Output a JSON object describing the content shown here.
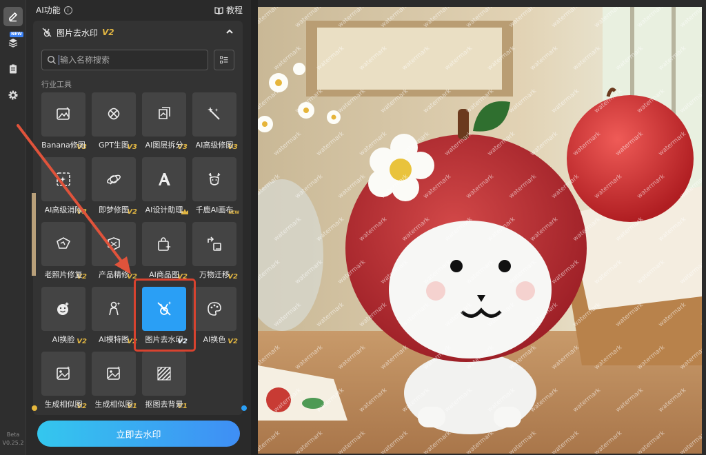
{
  "rail": {
    "new_tag": "NEW",
    "version_line1": "Beta",
    "version_line2": "V0.25.2"
  },
  "header": {
    "title": "AI功能",
    "tutorial": "教程"
  },
  "tool": {
    "title": "图片去水印",
    "version": "V2"
  },
  "search": {
    "placeholder": "输入名称搜索"
  },
  "section_title": "行业工具",
  "tiles": [
    {
      "label": "Banana修图",
      "tag": "V3",
      "icon": "image-edit-icon"
    },
    {
      "label": "GPT生图",
      "tag": "V3",
      "icon": "knot-icon"
    },
    {
      "label": "AI图层拆分",
      "tag": "V3",
      "icon": "layer-split-icon"
    },
    {
      "label": "AI高级修图",
      "tag": "V3",
      "icon": "magic-wand-icon"
    },
    {
      "label": "AI高级消除",
      "tag": "V3",
      "icon": "eraser-frame-icon"
    },
    {
      "label": "即梦修图",
      "tag": "V2",
      "icon": "planet-brush-icon"
    },
    {
      "label": "AI设计助理",
      "tag": "",
      "icon": "letter-a-icon"
    },
    {
      "label": "千鹿AI画布",
      "tag": "NEW",
      "icon": "deer-icon"
    },
    {
      "label": "老照片修复",
      "tag": "V2",
      "icon": "photo-repair-icon"
    },
    {
      "label": "产品精修",
      "tag": "V2",
      "icon": "product-retouch-icon"
    },
    {
      "label": "AI商品图",
      "tag": "V2",
      "icon": "shopping-bag-icon"
    },
    {
      "label": "万物迁移",
      "tag": "V2",
      "icon": "transfer-icon"
    },
    {
      "label": "AI换脸",
      "tag": "V2",
      "icon": "face-swap-icon"
    },
    {
      "label": "AI模特图",
      "tag": "V2",
      "icon": "model-icon"
    },
    {
      "label": "图片去水印",
      "tag": "V2",
      "icon": "watermark-remove-icon"
    },
    {
      "label": "AI换色",
      "tag": "V2",
      "icon": "palette-icon"
    },
    {
      "label": "生成相似图",
      "tag": "V2",
      "icon": "similar-image-icon"
    },
    {
      "label": "生成相似图",
      "tag": "V1",
      "icon": "similar-image-icon"
    },
    {
      "label": "抠图去背景",
      "tag": "V1",
      "icon": "cutout-icon"
    }
  ],
  "cta": "立即去水印",
  "canvas": {
    "watermark_text": "watermark"
  }
}
